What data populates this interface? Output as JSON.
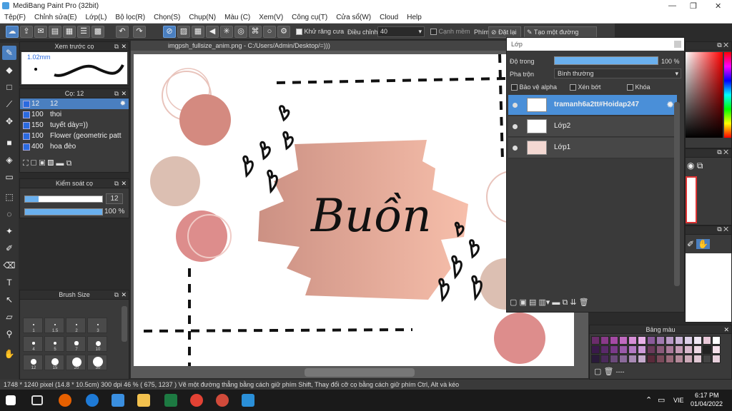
{
  "window": {
    "title": "MediBang Paint Pro (32bit)",
    "min": "—",
    "max": "❐",
    "close": "✕"
  },
  "menu": [
    "Tệp(F)",
    "Chỉnh sửa(E)",
    "Lớp(L)",
    "Bộ lọc(R)",
    "Chọn(S)",
    "Chụp(N)",
    "Màu (C)",
    "Xem(V)",
    "Công cụ(T)",
    "Cửa sổ(W)",
    "Cloud",
    "Help"
  ],
  "toolbar": {
    "antialias_label": "Khử răng cưa",
    "adjust_label": "Điều chỉnh",
    "adjust_value": "40",
    "edge_label": "Cạnh mềm",
    "key_label": "Phím",
    "reset_label": "Đặt lại",
    "line_label": "Tạo một đường thẳng"
  },
  "brush_preview": {
    "title": "Xem trước cọ",
    "size": "1.02mm"
  },
  "brush_list": {
    "title": "Cọ: 12",
    "items": [
      {
        "n": "12",
        "name": "12",
        "selected": true
      },
      {
        "n": "100",
        "name": "thoi",
        "selected": false
      },
      {
        "n": "150",
        "name": "tuyết dày=))",
        "selected": false
      },
      {
        "n": "100",
        "name": "Flower (geometric patt",
        "selected": false
      },
      {
        "n": "400",
        "name": "hoa đèo",
        "selected": false
      }
    ]
  },
  "brush_control": {
    "title": "Kiểm soát cọ",
    "size_value": "12",
    "opacity_value": "100 %",
    "opacity_fraction": 1.0,
    "size_fraction": 0.18
  },
  "brush_size": {
    "title": "Brush Size",
    "labels": [
      "1",
      "1.5",
      "2",
      "3",
      "4",
      "5",
      "7",
      "10",
      "12",
      "15",
      "20",
      "30"
    ]
  },
  "document": {
    "tab": "imgpsh_fullsize_anim.png - C:/Users/Admin/Desktop/=)))",
    "artwork_text": "Buồn"
  },
  "layer_panel": {
    "title": "Lớp",
    "opacity_label": "Độ trong",
    "opacity_value": "100 %",
    "opacity_fraction": 1.0,
    "blend_label": "Pha trộn",
    "blend_value": "Bình thường",
    "alpha_label": "Bảo vệ alpha",
    "clip_label": "Xén bớt",
    "lock_label": "Khóa",
    "layers": [
      {
        "name": "tramanh6a2tt#Hoidap247",
        "selected": true
      },
      {
        "name": "Lớp2",
        "selected": false
      },
      {
        "name": "Lớp1",
        "selected": false
      }
    ]
  },
  "palette": {
    "title": "Bảng màu",
    "separator": "----"
  },
  "status": {
    "text": "1748 * 1240 pixel   (14.8 * 10.5cm)   300 dpi   46 %   ( 675, 1237 )   Vẽ một đường thẳng bằng cách giữ phím Shift, Thay đổi cỡ cọ bằng cách giữ phím Ctrl, Alt và kéo"
  },
  "taskbar": {
    "lang": "VIE",
    "time": "6:17 PM",
    "date": "01/04/2022"
  }
}
